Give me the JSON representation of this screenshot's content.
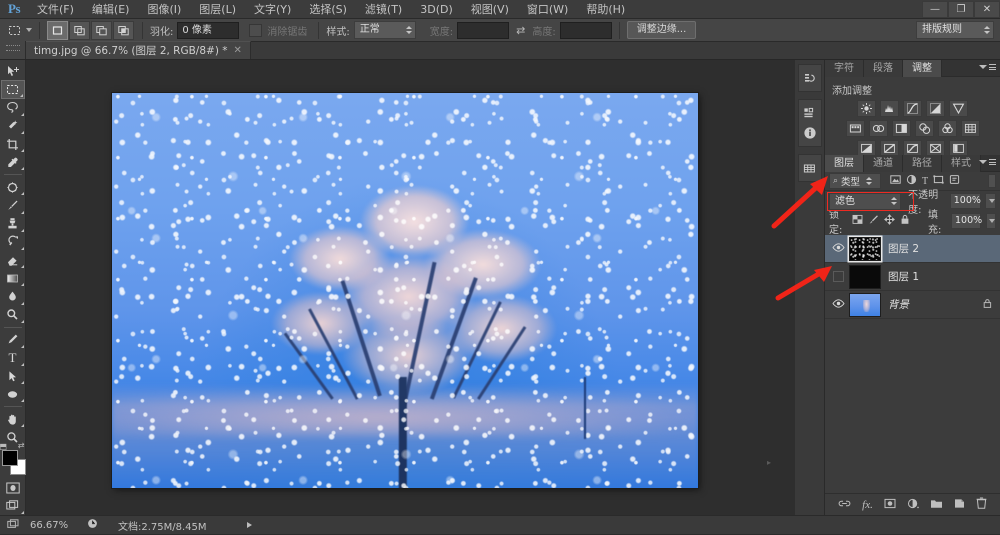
{
  "app": {
    "logo": "Ps",
    "menu": [
      {
        "label": "文件(F)"
      },
      {
        "label": "编辑(E)"
      },
      {
        "label": "图像(I)"
      },
      {
        "label": "图层(L)"
      },
      {
        "label": "文字(Y)"
      },
      {
        "label": "选择(S)"
      },
      {
        "label": "滤镜(T)"
      },
      {
        "label": "3D(D)"
      },
      {
        "label": "视图(V)"
      },
      {
        "label": "窗口(W)"
      },
      {
        "label": "帮助(H)"
      }
    ],
    "window_controls": {
      "minimize": "—",
      "restore": "❐",
      "close": "✕"
    }
  },
  "options_bar": {
    "tool_icon": "rectangular-marquee",
    "selection_modes": [
      "new-selection",
      "add-to-selection",
      "subtract-from-selection",
      "intersect-selection"
    ],
    "feather_label": "羽化:",
    "feather_value": "0 像素",
    "antialias_label": "消除锯齿",
    "style_label": "样式:",
    "style_value": "正常",
    "width_label": "宽度:",
    "width_value": "",
    "height_label": "高度:",
    "height_value": "",
    "swap_icon": "swap-dimensions",
    "refine_edge_button": "调整边缘...",
    "workspace_selector": "排版规则"
  },
  "document_tab": {
    "title": "timg.jpg @ 66.7% (图层 2, RGB/8#) *",
    "close": "✕"
  },
  "toolbar": {
    "tools": [
      {
        "name": "move-tool",
        "glyph": "⊹",
        "selected": false,
        "has_submenu": false
      },
      {
        "name": "rectangular-marquee-tool",
        "glyph": "▭",
        "selected": true,
        "has_submenu": true
      },
      {
        "name": "lasso-tool",
        "glyph": "◠",
        "selected": false,
        "has_submenu": true
      },
      {
        "name": "quick-selection-tool",
        "glyph": "✦",
        "selected": false,
        "has_submenu": true
      },
      {
        "name": "crop-tool",
        "glyph": "⌗",
        "selected": false,
        "has_submenu": true
      },
      {
        "name": "eyedropper-tool",
        "glyph": "✒",
        "selected": false,
        "has_submenu": true
      },
      {
        "name": "spot-healing-brush-tool",
        "glyph": "✺",
        "selected": false,
        "has_submenu": true
      },
      {
        "name": "brush-tool",
        "glyph": "╱",
        "selected": false,
        "has_submenu": true
      },
      {
        "name": "clone-stamp-tool",
        "glyph": "⚘",
        "selected": false,
        "has_submenu": true
      },
      {
        "name": "history-brush-tool",
        "glyph": "❧",
        "selected": false,
        "has_submenu": true
      },
      {
        "name": "eraser-tool",
        "glyph": "◗",
        "selected": false,
        "has_submenu": true
      },
      {
        "name": "gradient-tool",
        "glyph": "◑",
        "selected": false,
        "has_submenu": true
      },
      {
        "name": "blur-tool",
        "glyph": "💧",
        "selected": false,
        "has_submenu": true
      },
      {
        "name": "dodge-tool",
        "glyph": "◍",
        "selected": false,
        "has_submenu": true
      },
      {
        "name": "pen-tool",
        "glyph": "✎",
        "selected": false,
        "has_submenu": true
      },
      {
        "name": "type-tool",
        "glyph": "T",
        "selected": false,
        "has_submenu": true
      },
      {
        "name": "path-selection-tool",
        "glyph": "➤",
        "selected": false,
        "has_submenu": true
      },
      {
        "name": "ellipse-shape-tool",
        "glyph": "⬭",
        "selected": false,
        "has_submenu": true
      },
      {
        "name": "hand-tool",
        "glyph": "✋",
        "selected": false,
        "has_submenu": true
      },
      {
        "name": "zoom-tool",
        "glyph": "🔍",
        "selected": false,
        "has_submenu": false
      }
    ],
    "default_colors_icon": "default-colors",
    "swap_colors_icon": "swap-colors",
    "foreground_color": "#000000",
    "background_color": "#ffffff",
    "quick_mask_icon": "quick-mask-mode",
    "screen_mode_icon": "screen-mode"
  },
  "minidock": {
    "groups": [
      {
        "icons": [
          "history-panel-icon"
        ]
      },
      {
        "icons": [
          "actions-panel-icon",
          "info-panel-icon"
        ]
      },
      {
        "icons": [
          "swatches-panel-icon"
        ]
      }
    ]
  },
  "adjustments_panel": {
    "tabs": [
      {
        "label": "字符",
        "active": false
      },
      {
        "label": "段落",
        "active": false
      },
      {
        "label": "调整",
        "active": true
      }
    ],
    "title": "添加调整",
    "rows": [
      [
        "brightness-contrast-icon",
        "levels-icon",
        "curves-icon",
        "exposure-icon",
        "vibrance-icon"
      ],
      [
        "hue-saturation-icon",
        "color-balance-icon",
        "black-white-icon",
        "photo-filter-icon",
        "channel-mixer-icon",
        "color-lookup-icon"
      ],
      [
        "invert-icon",
        "posterize-icon",
        "threshold-icon",
        "selective-color-icon",
        "gradient-map-icon"
      ]
    ]
  },
  "layers_panel": {
    "tabs": [
      {
        "label": "图层",
        "active": true
      },
      {
        "label": "通道",
        "active": false
      },
      {
        "label": "路径",
        "active": false
      },
      {
        "label": "样式",
        "active": false
      }
    ],
    "filter": {
      "icon": "search-icon",
      "type_label": "类型",
      "filter_icons": [
        "pixel-filter-icon",
        "adjustment-filter-icon",
        "type-filter-icon",
        "shape-filter-icon",
        "smart-object-filter-icon"
      ],
      "toggle_icon": "filter-toggle"
    },
    "blend_mode": "滤色",
    "blend_mode_highlight_color": "#ee2a22",
    "opacity_label": "不透明度:",
    "opacity_value": "100%",
    "lock_label": "锁定:",
    "lock_icons": [
      "lock-transparent-pixels-icon",
      "lock-image-pixels-icon",
      "lock-position-icon",
      "lock-all-icon"
    ],
    "fill_label": "填充:",
    "fill_value": "100%",
    "layers": [
      {
        "name": "图层 2",
        "visible": true,
        "selected": true,
        "thumb": "noise",
        "locked": false
      },
      {
        "name": "图层 1",
        "visible": false,
        "selected": false,
        "thumb": "black",
        "locked": false
      },
      {
        "name": "背景",
        "visible": true,
        "selected": false,
        "thumb": "photo",
        "locked": true,
        "lock_icon": "lock-icon"
      }
    ],
    "bottom_icons": [
      {
        "name": "link-layers-icon",
        "glyph": "∞"
      },
      {
        "name": "layer-style-fx-icon",
        "glyph": "fx"
      },
      {
        "name": "add-layer-mask-icon",
        "glyph": "▣"
      },
      {
        "name": "new-fill-adjustment-icon",
        "glyph": "◑"
      },
      {
        "name": "new-group-icon",
        "glyph": "▰"
      },
      {
        "name": "new-layer-icon",
        "glyph": "❐"
      },
      {
        "name": "delete-layer-icon",
        "glyph": "🗑"
      }
    ]
  },
  "annotations": {
    "arrow_color": "#f02418",
    "arrow_blend_mode_target": "滤色",
    "arrow_visibility_target": "图层 1"
  },
  "status_bar": {
    "zoom": "66.67%",
    "doc_label": "文档:2.75M/8.45M",
    "grip_icon": "resize-grip-icon",
    "clock_icon": "timing-icon"
  },
  "canvas": {
    "image_description": "frost-covered-tree-snow-scene",
    "sky_color": "#5f95ea",
    "tree_color": "#eed6d8",
    "trunk_color": "#223966"
  }
}
